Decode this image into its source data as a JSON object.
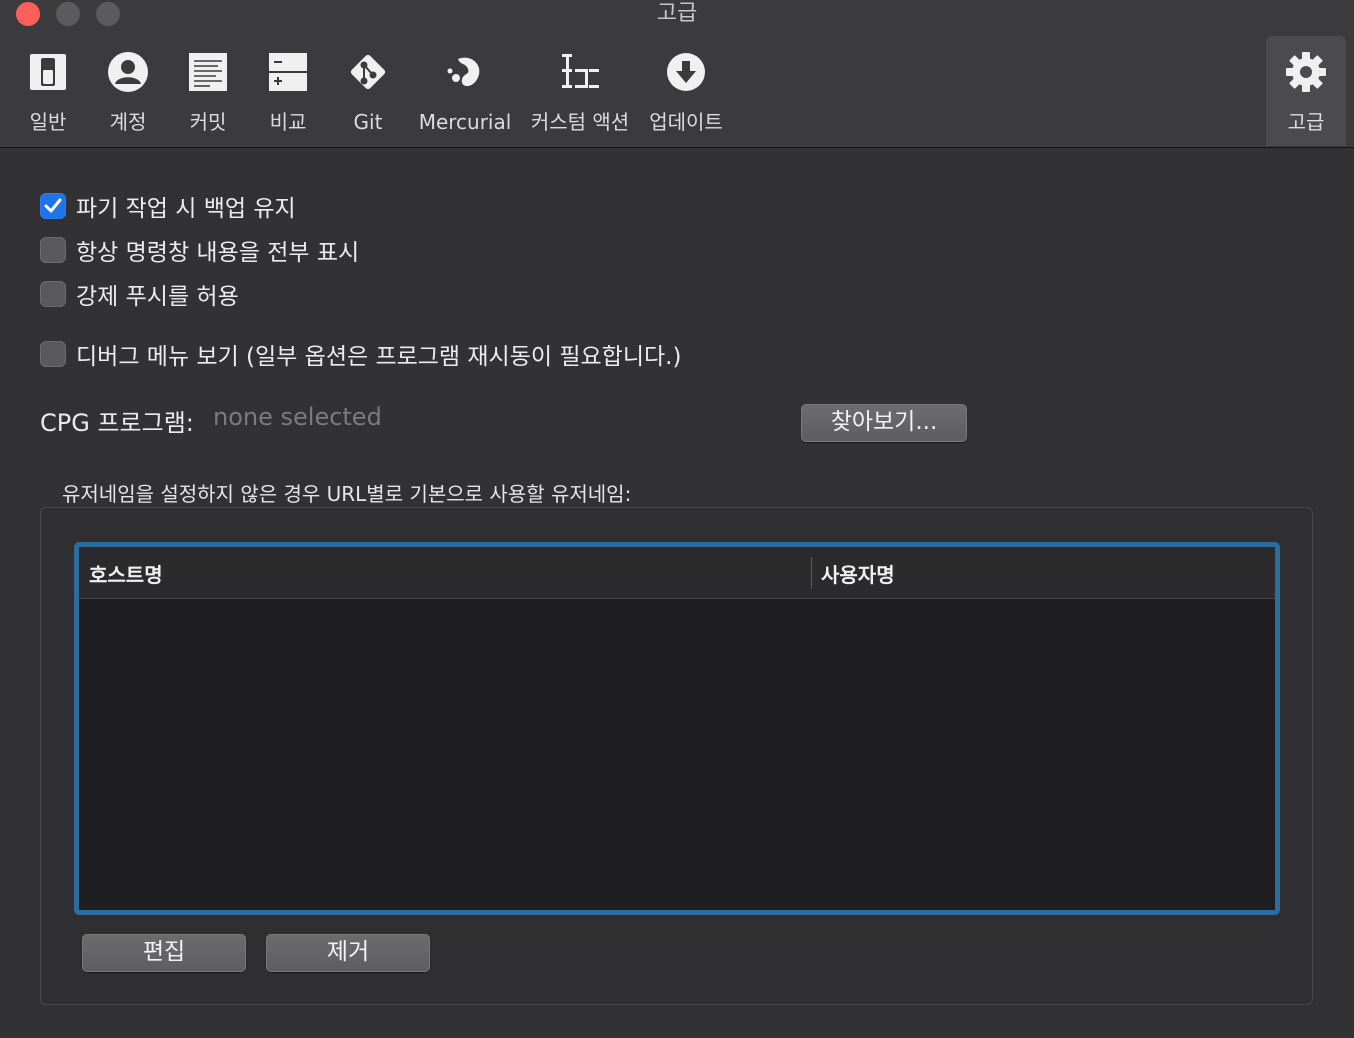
{
  "window": {
    "title": "고급"
  },
  "toolbar": {
    "items": [
      {
        "label": "일반",
        "icon": "general-icon"
      },
      {
        "label": "계정",
        "icon": "account-icon"
      },
      {
        "label": "커밋",
        "icon": "commit-icon"
      },
      {
        "label": "비교",
        "icon": "diff-icon"
      },
      {
        "label": "Git",
        "icon": "git-icon"
      },
      {
        "label": "Mercurial",
        "icon": "mercurial-icon"
      },
      {
        "label": "커스텀 액션",
        "icon": "custom-actions-icon"
      },
      {
        "label": "업데이트",
        "icon": "update-icon"
      },
      {
        "label": "고급",
        "icon": "gear-icon",
        "selected": true
      }
    ]
  },
  "options": {
    "keep_backup": {
      "label": "파기 작업 시 백업 유지",
      "checked": true
    },
    "show_full_output": {
      "label": "항상 명령창 내용을 전부 표시",
      "checked": false
    },
    "allow_force_push": {
      "label": "강제 푸시를 허용",
      "checked": false
    },
    "debug_menu": {
      "label": "디버그 메뉴 보기 (일부 옵션은 프로그램 재시동이 필요합니다.)",
      "checked": false
    }
  },
  "cpg": {
    "label": "CPG 프로그램:",
    "value": "none selected",
    "browse_label": "찾아보기..."
  },
  "usernames": {
    "caption": "유저네임을 설정하지 않은 경우 URL별로 기본으로 사용할 유저네임:",
    "columns": [
      "호스트명",
      "사용자명"
    ],
    "rows": [],
    "edit_label": "편집",
    "remove_label": "제거"
  },
  "colors": {
    "accent": "#1f73ea",
    "focus_ring": "#2d6d9e",
    "close": "#fe5f57"
  }
}
